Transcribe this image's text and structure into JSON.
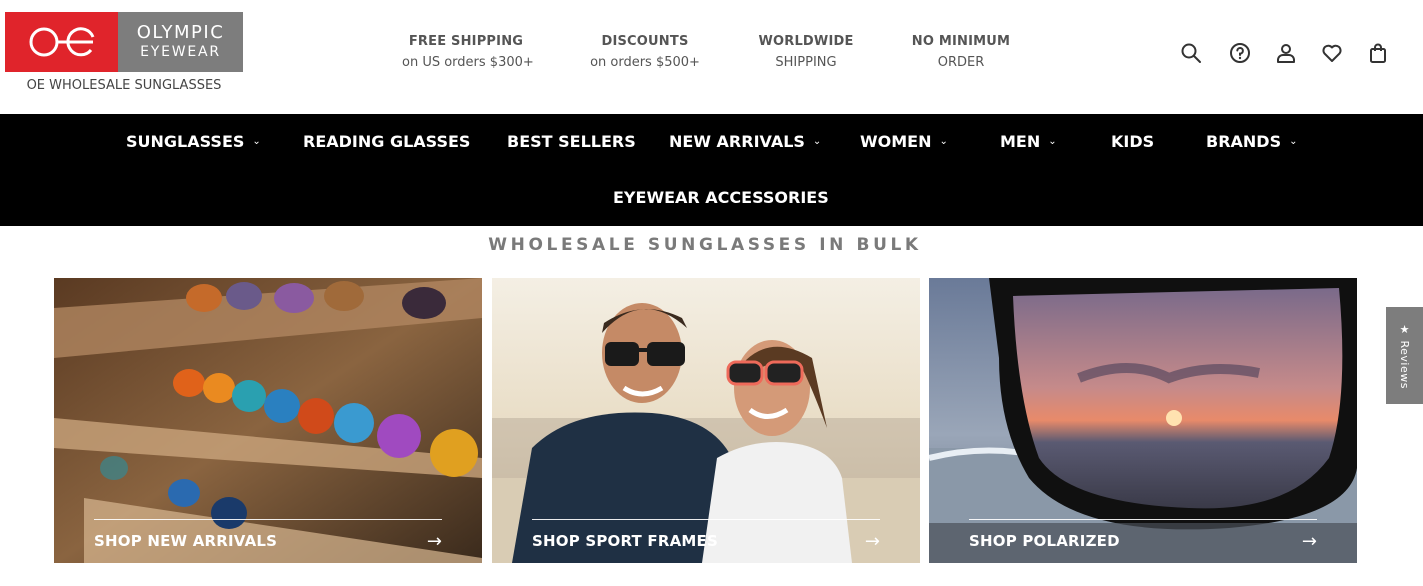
{
  "brand": {
    "name_line1": "OLYMPIC",
    "name_line2": "EYEWEAR",
    "tagline": "OE WHOLESALE SUNGLASSES",
    "primary_color": "#e0242b",
    "secondary_color": "#7d7d7d"
  },
  "perks": [
    {
      "title": "FREE SHIPPING",
      "subtitle": "on US orders $300+"
    },
    {
      "title": "DISCOUNTS",
      "subtitle": "on orders $500+"
    },
    {
      "title": "WORLDWIDE",
      "subtitle": "SHIPPING"
    },
    {
      "title": "NO MINIMUM",
      "subtitle": "ORDER"
    }
  ],
  "header_icons": [
    "search-icon",
    "help-icon",
    "account-icon",
    "wishlist-icon",
    "cart-icon"
  ],
  "nav": {
    "items": [
      {
        "label": "SUNGLASSES",
        "has_dropdown": true
      },
      {
        "label": "READING GLASSES",
        "has_dropdown": false
      },
      {
        "label": "BEST SELLERS",
        "has_dropdown": false
      },
      {
        "label": "NEW ARRIVALS",
        "has_dropdown": true
      },
      {
        "label": "WOMEN",
        "has_dropdown": true
      },
      {
        "label": "MEN",
        "has_dropdown": true
      },
      {
        "label": "KIDS",
        "has_dropdown": false
      },
      {
        "label": "BRANDS",
        "has_dropdown": true
      },
      {
        "label": "EYEWEAR ACCESSORIES",
        "has_dropdown": false
      }
    ]
  },
  "section": {
    "title": "WHOLESALE SUNGLASSES IN BULK"
  },
  "tiles": [
    {
      "label": "SHOP NEW ARRIVALS"
    },
    {
      "label": "SHOP SPORT FRAMES"
    },
    {
      "label": "SHOP POLARIZED"
    }
  ],
  "reviews_tab": {
    "label": "★ Reviews"
  }
}
